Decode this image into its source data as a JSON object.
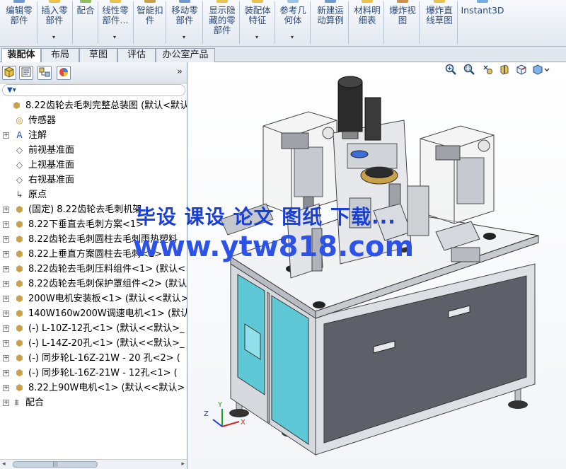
{
  "ribbon": {
    "buttons": [
      {
        "label": "编辑零\n部件",
        "has_dropdown": false
      },
      {
        "label": "插入零\n部件",
        "has_dropdown": true
      },
      {
        "label": "配合",
        "has_dropdown": false
      },
      {
        "label": "线性零\n部件...",
        "has_dropdown": true
      },
      {
        "label": "智能扣\n件",
        "has_dropdown": false
      },
      {
        "label": "移动零\n部件",
        "has_dropdown": true
      },
      {
        "label": "显示隐\n藏的零\n部件",
        "has_dropdown": false
      },
      {
        "label": "装配体\n特征",
        "has_dropdown": true
      },
      {
        "label": "参考几\n何体",
        "has_dropdown": true
      },
      {
        "label": "新建运\n动算例",
        "has_dropdown": false
      },
      {
        "label": "材料明\n细表",
        "has_dropdown": false
      },
      {
        "label": "爆炸视\n图",
        "has_dropdown": false
      },
      {
        "label": "爆炸直\n线草图",
        "has_dropdown": false
      },
      {
        "label": "Instant3D",
        "has_dropdown": false
      }
    ],
    "dropdown_glyph": "▾"
  },
  "tabs": [
    "装配体",
    "布局",
    "草图",
    "评估",
    "办公室产品"
  ],
  "active_tab": 0,
  "panel": {
    "toolbar_icons": [
      "feature-manager-icon",
      "property-manager-icon",
      "configuration-manager-icon",
      "appearance-icon"
    ],
    "expand_glyph": "»",
    "filter_glyph": "▼▾"
  },
  "tree": [
    {
      "text": "8.22齿轮去毛刺完整总装图  (默认<默认",
      "icon": "assembly-icon",
      "indent": 0,
      "expander": false
    },
    {
      "text": "传感器",
      "icon": "sensor-icon",
      "indent": 1,
      "expander": false
    },
    {
      "text": "注解",
      "icon": "annotation-icon",
      "indent": 1,
      "expander": true
    },
    {
      "text": "前视基准面",
      "icon": "plane-icon",
      "indent": 1,
      "expander": false
    },
    {
      "text": "上视基准面",
      "icon": "plane-icon",
      "indent": 1,
      "expander": false
    },
    {
      "text": "右视基准面",
      "icon": "plane-icon",
      "indent": 1,
      "expander": false
    },
    {
      "text": "原点",
      "icon": "origin-icon",
      "indent": 1,
      "expander": false
    },
    {
      "text": "(固定) 8.22齿轮去毛刺机架",
      "icon": "subassembly-icon",
      "indent": 1,
      "expander": true
    },
    {
      "text": "8.22下垂直去毛刺方案<1>",
      "icon": "subassembly-icon",
      "indent": 1,
      "expander": true
    },
    {
      "text": "8.22齿轮去毛刺圆柱去毛刺雨热塑料",
      "icon": "subassembly-icon",
      "indent": 1,
      "expander": true
    },
    {
      "text": "8.22上垂直方案圆柱去毛刺<1>",
      "icon": "subassembly-icon",
      "indent": 1,
      "expander": true
    },
    {
      "text": "8.22齿轮去毛刺压料组件<1> (默认<",
      "icon": "subassembly-icon",
      "indent": 1,
      "expander": true
    },
    {
      "text": "8.22齿轮去毛刺保护罩组件<2> (默认",
      "icon": "subassembly-icon",
      "indent": 1,
      "expander": true
    },
    {
      "text": "200W电机安装板<1> (默认<<默认>",
      "icon": "part-icon",
      "indent": 1,
      "expander": true
    },
    {
      "text": "140W160w200W调速电机<1> (默认",
      "icon": "part-icon",
      "indent": 1,
      "expander": true
    },
    {
      "text": "(-) L-10Z-12孔<1> (默认<<默认>_",
      "icon": "part-icon",
      "indent": 1,
      "expander": true
    },
    {
      "text": "(-) L-14Z-20孔<1> (默认<<默认>_",
      "icon": "part-icon",
      "indent": 1,
      "expander": true
    },
    {
      "text": "(-) 同步轮L-16Z-21W - 20 孔<2> (",
      "icon": "part-icon",
      "indent": 1,
      "expander": true
    },
    {
      "text": "(-) 同步轮L-16Z-21W - 12孔<1> (",
      "icon": "part-icon",
      "indent": 1,
      "expander": true
    },
    {
      "text": "8.22上90W电机<1> (默认<<默认>",
      "icon": "part-icon",
      "indent": 1,
      "expander": true
    },
    {
      "text": "配合",
      "icon": "mates-icon",
      "indent": 0,
      "expander": true
    }
  ],
  "scrollbar": {
    "left_arrow": "◂",
    "right_arrow": "▸",
    "grip": "|||"
  },
  "viewport": {
    "watermark_line1": "毕设 课设 论文 图纸 下载...",
    "watermark_line2": "www.ytw818.com",
    "view_tools": [
      "zoom-to-fit-icon",
      "zoom-area-icon",
      "previous-view-icon",
      "section-view-icon",
      "view-orientation-icon",
      "display-style-icon"
    ],
    "triad": {
      "x": "X",
      "y": "Y",
      "z": "Z"
    }
  },
  "colors": {
    "accent": "#2a4a7a",
    "watermark": "#1a3fd6",
    "frame": "#cfd2d8",
    "panel_cyan": "#5ec8d6",
    "motor": "#2b2b2b"
  }
}
